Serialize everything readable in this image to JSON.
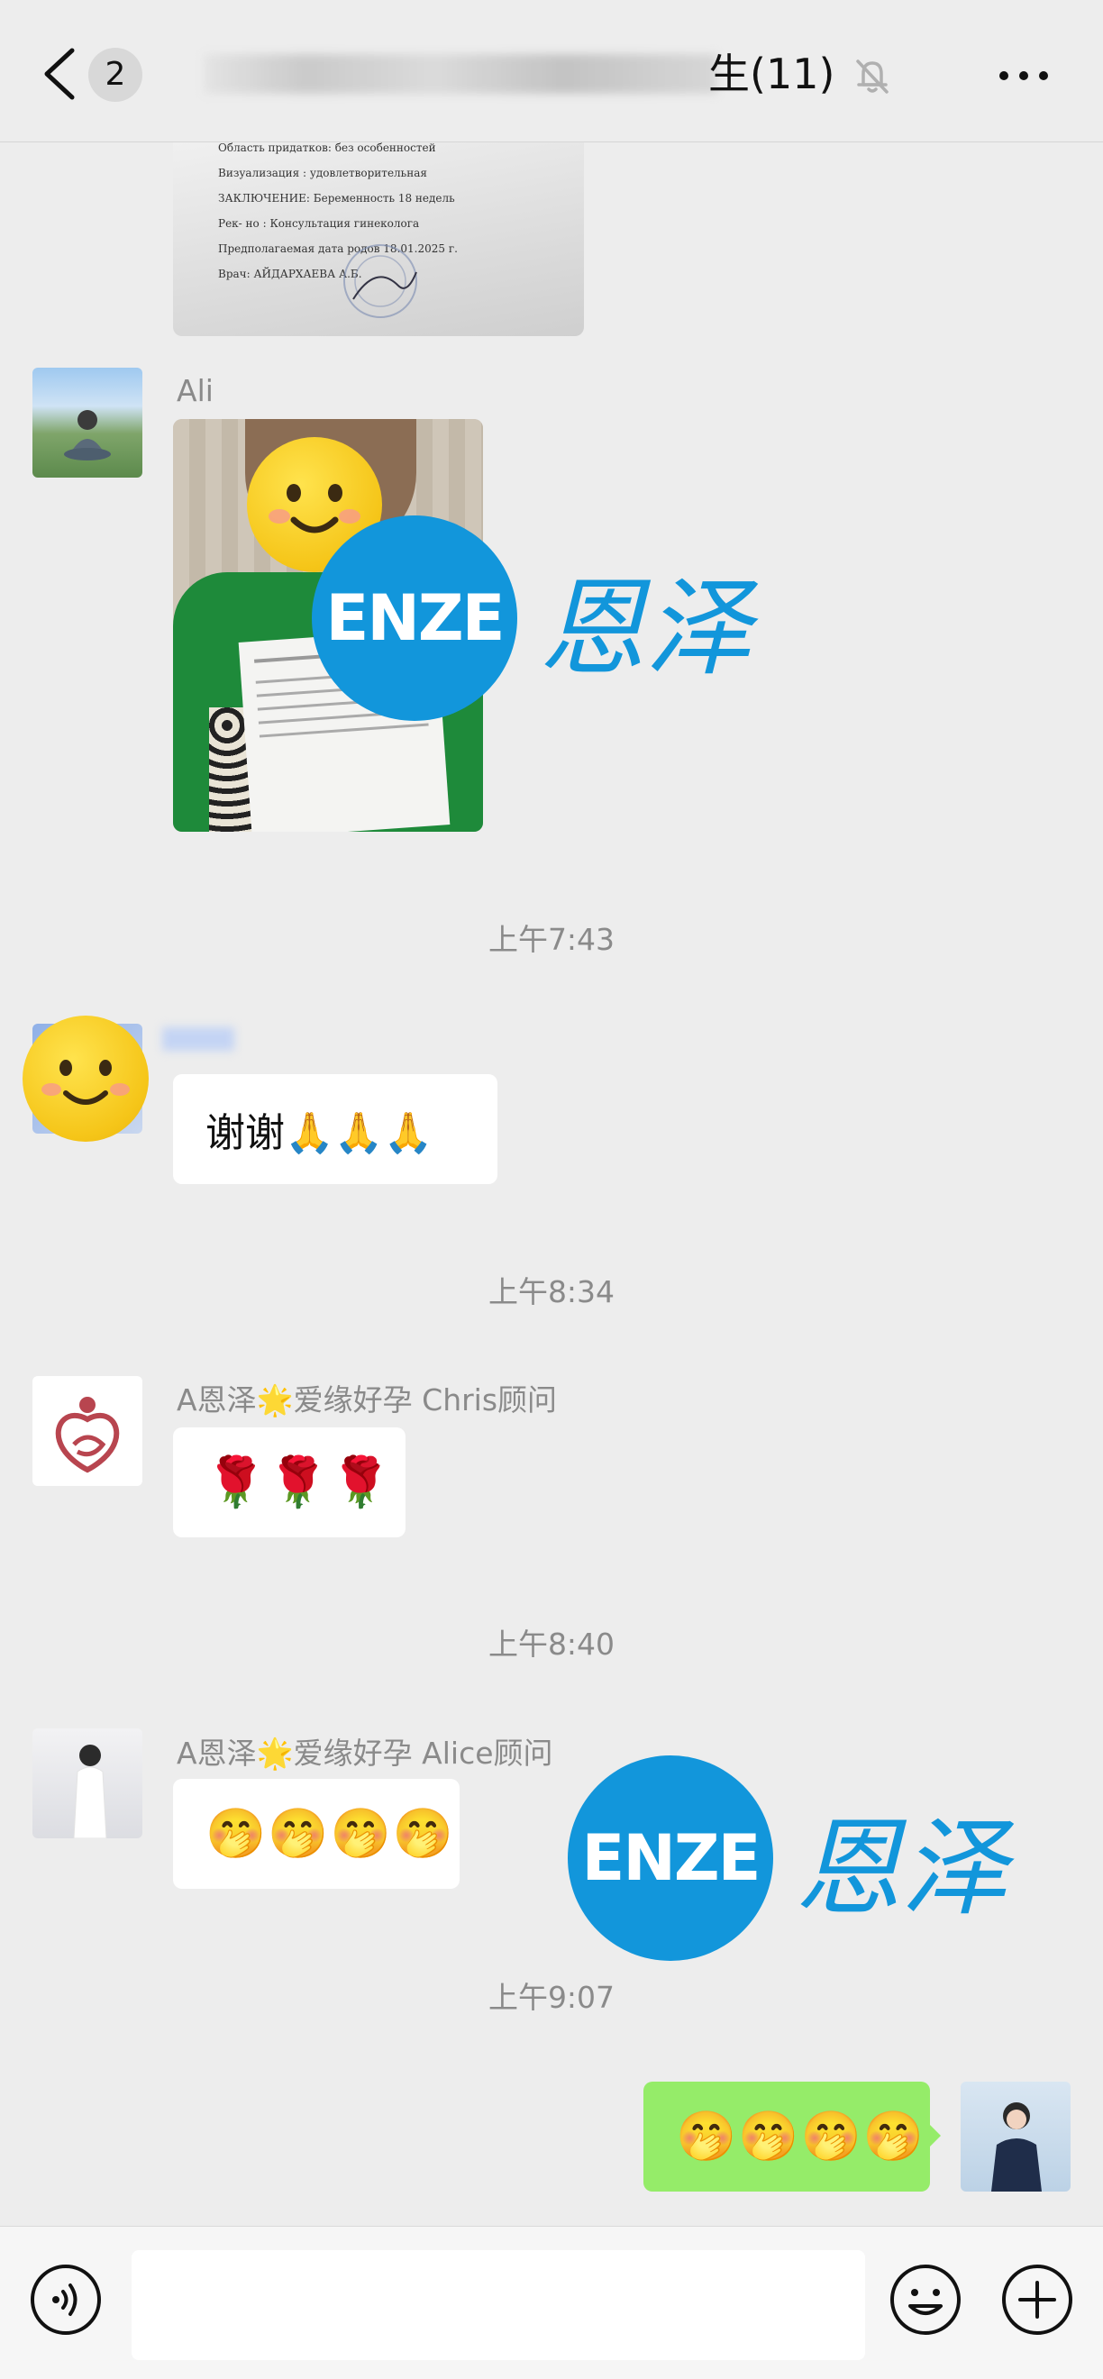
{
  "header": {
    "badge": "2",
    "title": "生(11)",
    "icons": {
      "back": "chevron-left-icon",
      "mute": "bell-off-icon",
      "more": "ellipsis-icon"
    }
  },
  "doc_image": {
    "lines": [
      "Область придатков: без особенностей",
      "Визуализация : удовлетворительная",
      "ЗАКЛЮЧЕНИЕ: Беременность 18 недель",
      "Рек- но : Консультация гинеколога",
      "Предполагаемая дата родов 18.01.2025 г.",
      "Врач: АЙДАРХАЕВА А.Б."
    ]
  },
  "messages": [
    {
      "sender": "Ali",
      "type": "image"
    },
    {
      "time": "上午7:43"
    },
    {
      "sender": "",
      "type": "text",
      "text": "谢谢🙏🙏🙏"
    },
    {
      "time": "上午8:34"
    },
    {
      "sender": "A恩泽🌟爱缘好孕 Chris顾问",
      "type": "emoji",
      "emojis": [
        "🌹",
        "🌹",
        "🌹"
      ]
    },
    {
      "time": "上午8:40"
    },
    {
      "sender": "A恩泽🌟爱缘好孕 Alice顾问",
      "type": "emoji",
      "emojis": [
        "🤭",
        "🤭",
        "🤭",
        "🤭"
      ]
    },
    {
      "time": "上午9:07"
    },
    {
      "sender": "me",
      "type": "emoji",
      "emojis": [
        "🤭",
        "🤭",
        "🤭",
        "🤭"
      ]
    }
  ],
  "watermark": {
    "logo": "ENZE",
    "text": "恩泽"
  },
  "input_bar": {
    "placeholder": "",
    "icons": {
      "voice": "voice-icon",
      "emoji": "smiley-face-icon",
      "plus": "plus-circle-icon"
    }
  },
  "colors": {
    "background": "#ededed",
    "own_bubble": "#95ec69",
    "watermark_blue": "#1296db"
  }
}
